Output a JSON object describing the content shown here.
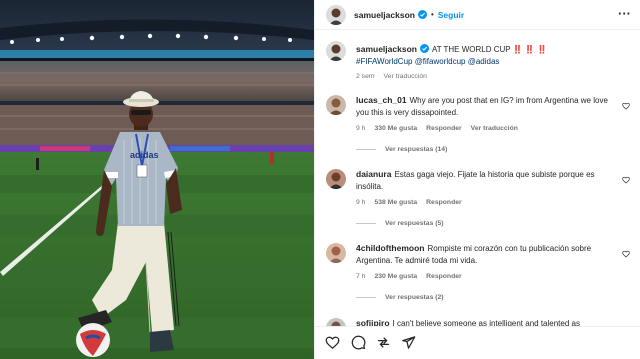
{
  "post": {
    "author": "samueljackson",
    "follow_label": "Seguir",
    "caption_text": "AT THE WORLD CUP",
    "caption_emoji": "‼️ ‼️ ‼️",
    "hashtags": "#FIFAWorldCup @fifaworldcup @adidas",
    "time_ago": "2 sem",
    "translate_label": "Ver traducción"
  },
  "comments": [
    {
      "username": "lucas_ch_01",
      "text": "Why are you post that en IG? im from Argentina we love you this is very dissapointed.",
      "time": "9 h",
      "likes": "330 Me gusta",
      "reply_label": "Responder",
      "translate_label": "Ver traducción",
      "replies_label": "Ver respuestas (14)"
    },
    {
      "username": "daianura",
      "text": "Estas gaga viejo. Fijate la historia que subiste porque es insólita.",
      "time": "9 h",
      "likes": "538 Me gusta",
      "reply_label": "Responder",
      "replies_label": "Ver respuestas (5)"
    },
    {
      "username": "4childofthemoon",
      "text": "Rompiste mi corazón con tu publicación sobre Argentina. Te admiré toda mi vida.",
      "time": "7 h",
      "likes": "230 Me gusta",
      "reply_label": "Responder",
      "replies_label": "Ver respuestas (2)"
    },
    {
      "username": "sofiipiro",
      "text": "I can't believe someone as intelligent and talented as"
    }
  ],
  "colors": {
    "link_blue": "#0095f6",
    "hashtag_blue": "#00376b",
    "verified_blue": "#0095f6",
    "secondary_text": "#737373"
  },
  "icons": [
    "verified-icon",
    "more-options-icon",
    "heart-icon",
    "comment-icon",
    "share-icon",
    "send-icon"
  ]
}
